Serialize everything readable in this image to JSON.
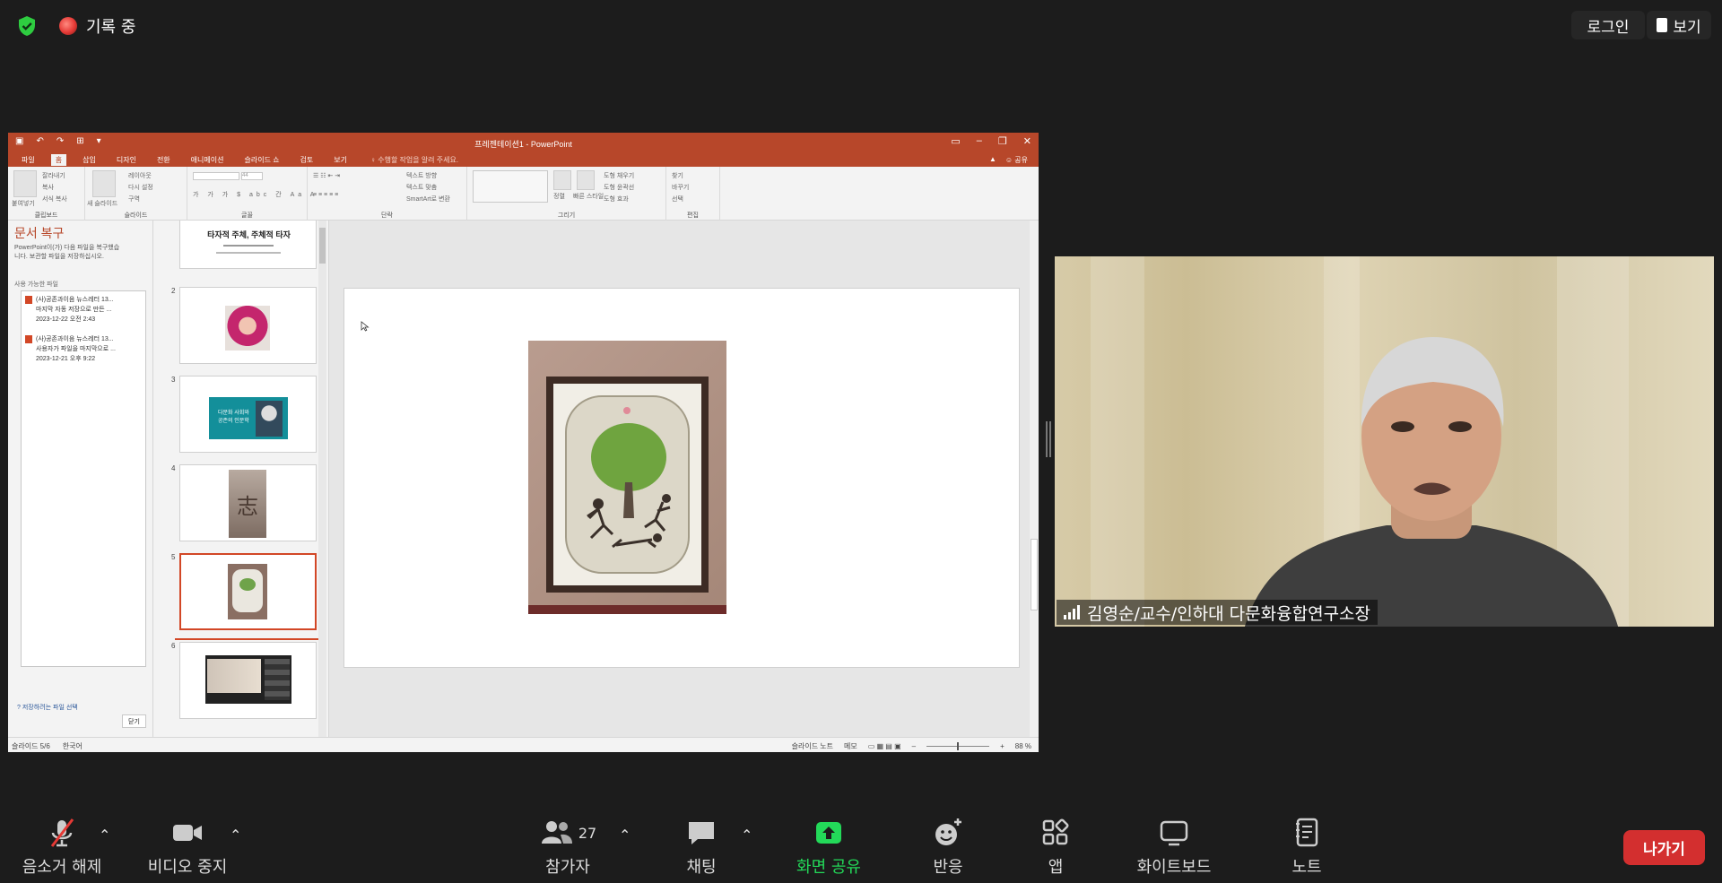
{
  "top_bar": {
    "recording_label": "기록 중",
    "login_label": "로그인",
    "view_label": "보기"
  },
  "shared_screen": {
    "window_title": "프레젠테이션1 - PowerPoint",
    "tabs": [
      "파일",
      "홈",
      "삽입",
      "디자인",
      "전환",
      "애니메이션",
      "슬라이드 쇼",
      "검토",
      "보기"
    ],
    "tell_me": "수행할 작업을 알려 주세요.",
    "share_label": "공유",
    "ribbon_groups": {
      "clipboard": "클립보드",
      "slides": "슬라이드",
      "font": "글꼴",
      "paragraph": "단락",
      "drawing": "그리기",
      "editing": "편집"
    },
    "ribbon_labels": {
      "paste": "붙여넣기",
      "cut": "잘라내기",
      "copy": "복사",
      "format_painter": "서식 복사",
      "new_slide": "새 슬라이드",
      "layout": "레이아웃",
      "reset": "다시 설정",
      "section": "구역",
      "font_size": "44",
      "text_direction": "텍스트 방향",
      "align_text": "텍스트 맞춤",
      "smartart": "SmartArt로 변환",
      "arrange": "정렬",
      "quick_styles": "빠른 스타일",
      "shape_fill": "도형 채우기",
      "shape_outline": "도형 윤곽선",
      "shape_effects": "도형 효과",
      "find": "찾기",
      "replace": "바꾸기",
      "select": "선택"
    },
    "recovery": {
      "title": "문서 복구",
      "description": "PowerPoint이(가) 다음 파일을 복구했습니다. 보관할 파일을 저장하십시오.",
      "available_label": "사용 가능한 파일",
      "files": [
        {
          "name": "(사)공존과이음 뉴스레터 13...",
          "detail": "마지막 자동 저장으로 만든 ...",
          "date": "2023-12-22 오전 2:43"
        },
        {
          "name": "(사)공존과이음 뉴스레터 13...",
          "detail": "사용자가 파일을 마지막으로 ...",
          "date": "2023-12-21 오후 9:22"
        }
      ],
      "link": "저장하려는 파일 선택",
      "close_label": "닫기"
    },
    "thumbnails": [
      {
        "num": "",
        "title": "타자적 주체, 주체적 타자"
      },
      {
        "num": "2"
      },
      {
        "num": "3",
        "caption_line1": "다문화 사회와",
        "caption_line2": "공존의 인문학"
      },
      {
        "num": "4",
        "glyph": "志"
      },
      {
        "num": "5"
      },
      {
        "num": "6"
      }
    ],
    "status": {
      "slide_info": "슬라이드 5/6",
      "language": "한국어",
      "notes": "슬라이드 노트",
      "comments": "메모",
      "zoom": "88 %"
    }
  },
  "video": {
    "participant_name": "김영순/교수/인하대 다문화융합연구소장"
  },
  "toolbar": {
    "mute_label": "음소거 해제",
    "video_label": "비디오 중지",
    "participants_label": "참가자",
    "participants_count": "27",
    "chat_label": "채팅",
    "share_label": "화면 공유",
    "reactions_label": "반응",
    "apps_label": "앱",
    "whiteboard_label": "화이트보드",
    "notes_label": "노트",
    "leave_label": "나가기"
  },
  "colors": {
    "ppt_brand": "#b7472a",
    "share_green": "#23d959",
    "leave_red": "#d32f2f",
    "secure_green": "#2ecc40"
  }
}
